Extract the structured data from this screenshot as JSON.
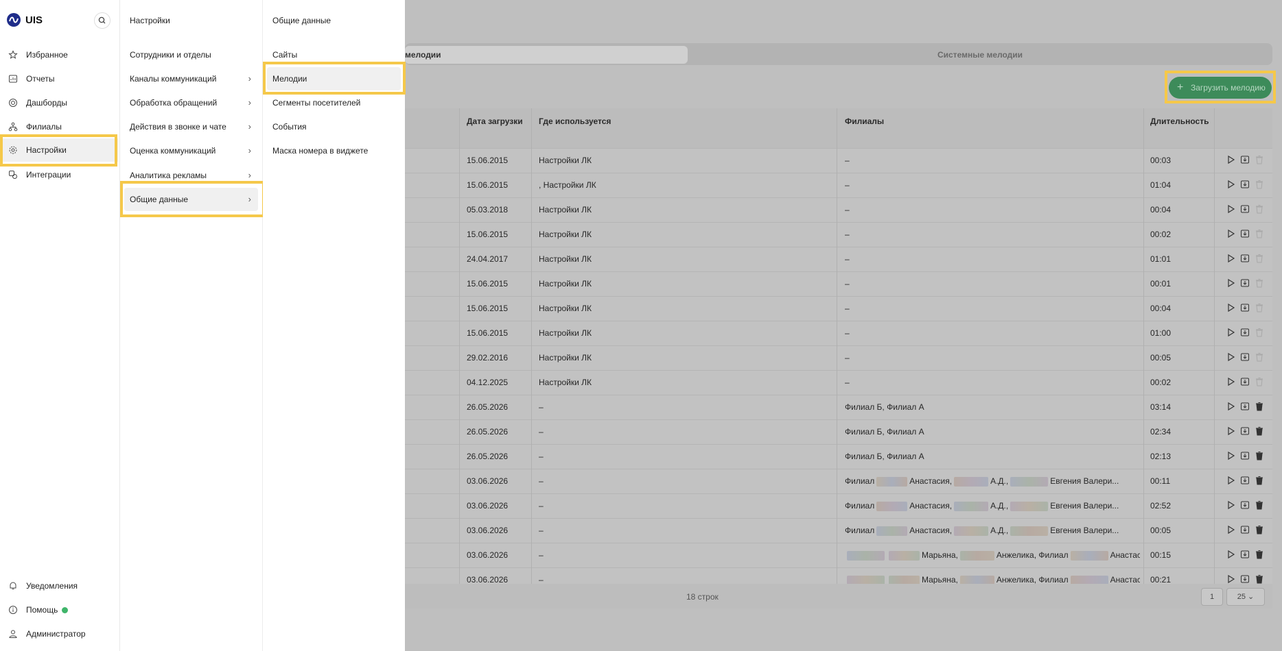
{
  "app": {
    "name": "UIS"
  },
  "nav": {
    "items": [
      {
        "label": "Избранное",
        "icon": "star-icon"
      },
      {
        "label": "Отчеты",
        "icon": "report-icon"
      },
      {
        "label": "Дашборды",
        "icon": "dashboard-icon"
      },
      {
        "label": "Филиалы",
        "icon": "branches-icon"
      },
      {
        "label": "Настройки",
        "icon": "gear-icon",
        "active": true
      },
      {
        "label": "Интеграции",
        "icon": "integrations-icon"
      }
    ],
    "bottom": [
      {
        "label": "Уведомления",
        "icon": "bell-icon"
      },
      {
        "label": "Помощь",
        "icon": "help-icon"
      },
      {
        "label": "Администратор",
        "icon": "user-icon"
      }
    ]
  },
  "settings_menu": {
    "title": "Настройки",
    "items": [
      {
        "label": "Сотрудники и отделы",
        "chevron": false
      },
      {
        "label": "Каналы коммуникаций",
        "chevron": true
      },
      {
        "label": "Обработка обращений",
        "chevron": true
      },
      {
        "label": "Действия в звонке и чате",
        "chevron": true
      },
      {
        "label": "Оценка коммуникаций",
        "chevron": true
      },
      {
        "label": "Аналитика рекламы",
        "chevron": true
      },
      {
        "label": "Общие данные",
        "chevron": true,
        "active": true
      }
    ]
  },
  "general_menu": {
    "title": "Общие данные",
    "items": [
      {
        "label": "Сайты"
      },
      {
        "label": "Мелодии",
        "active": true
      },
      {
        "label": "Сегменты посетителей"
      },
      {
        "label": "События"
      },
      {
        "label": "Маска номера в виджете"
      }
    ]
  },
  "main": {
    "tabs": [
      {
        "label": "мелодии",
        "active": true
      },
      {
        "label": "Системные мелодии"
      }
    ],
    "upload_label": "Загрузить мелодию",
    "columns": {
      "date": "Дата загрузки",
      "where": "Где используется",
      "branches": "Филиалы",
      "duration": "Длительность"
    },
    "rows": [
      {
        "date": "15.06.2015",
        "where": "Настройки ЛК",
        "branches": "–",
        "duration": "00:03",
        "deletable": false
      },
      {
        "date": "15.06.2015",
        "where": ", Настройки ЛК",
        "branches": "–",
        "duration": "01:04",
        "deletable": false
      },
      {
        "date": "05.03.2018",
        "where": "Настройки ЛК",
        "branches": "–",
        "duration": "00:04",
        "deletable": false
      },
      {
        "date": "15.06.2015",
        "where": "Настройки ЛК",
        "branches": "–",
        "duration": "00:02",
        "deletable": false
      },
      {
        "date": "24.04.2017",
        "where": "Настройки ЛК",
        "branches": "–",
        "duration": "01:01",
        "deletable": false
      },
      {
        "date": "15.06.2015",
        "where": "Настройки ЛК",
        "branches": "–",
        "duration": "00:01",
        "deletable": false
      },
      {
        "date": "15.06.2015",
        "where": "Настройки ЛК",
        "branches": "–",
        "duration": "00:04",
        "deletable": false
      },
      {
        "date": "15.06.2015",
        "where": "Настройки ЛК",
        "branches": "–",
        "duration": "01:00",
        "deletable": false
      },
      {
        "date": "29.02.2016",
        "where": "Настройки ЛК",
        "branches": "–",
        "duration": "00:05",
        "deletable": false
      },
      {
        "date": "04.12.2025",
        "where": "Настройки ЛК",
        "branches": "–",
        "duration": "00:02",
        "deletable": false
      },
      {
        "date": "26.05.2026",
        "where": "–",
        "branches": "Филиал Б, Филиал А",
        "duration": "03:14",
        "deletable": true
      },
      {
        "date": "26.05.2026",
        "where": "–",
        "branches": "Филиал Б, Филиал А",
        "duration": "02:34",
        "deletable": true
      },
      {
        "date": "26.05.2026",
        "where": "–",
        "branches": "Филиал Б, Филиал А",
        "duration": "02:13",
        "deletable": true
      },
      {
        "date": "03.06.2026",
        "where": "–",
        "branches_parts": [
          "Филиал",
          "Анастасия,",
          "А.Д.,",
          "Евгения Валери..."
        ],
        "duration": "00:11",
        "deletable": true
      },
      {
        "date": "03.06.2026",
        "where": "–",
        "branches_parts": [
          "Филиал",
          "Анастасия,",
          "А.Д.,",
          "Евгения Валери..."
        ],
        "duration": "02:52",
        "deletable": true
      },
      {
        "date": "03.06.2026",
        "where": "–",
        "branches_parts": [
          "Филиал",
          "Анастасия,",
          "А.Д.,",
          "Евгения Валери..."
        ],
        "duration": "00:05",
        "deletable": true
      },
      {
        "date": "03.06.2026",
        "where": "–",
        "branches_parts": [
          "",
          "Марьяна,",
          "Анжелика, Филиал",
          "Анастасия, Кол..."
        ],
        "duration": "00:15",
        "deletable": true
      },
      {
        "date": "03.06.2026",
        "where": "–",
        "branches_parts": [
          "",
          "Марьяна,",
          "Анжелика, Филиал",
          "Анастасия, Кол..."
        ],
        "duration": "00:21",
        "deletable": true
      }
    ],
    "footer": {
      "rows_count": "18 строк",
      "page": "1",
      "page_size": "25"
    }
  }
}
